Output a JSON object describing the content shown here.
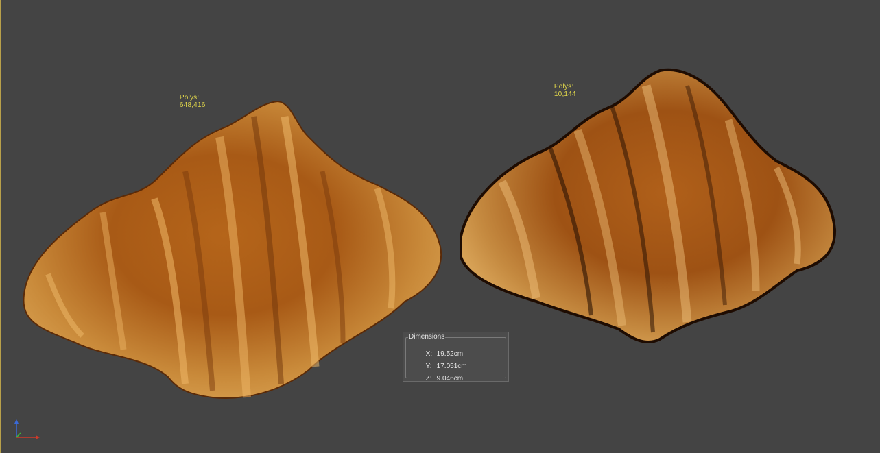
{
  "viewport": {
    "left_model": {
      "polys_label": "Polys:",
      "polys_value": "648,416"
    },
    "right_model": {
      "polys_label": "Polys:",
      "polys_value": "10,144"
    }
  },
  "dimensions": {
    "title": "Dimensions",
    "x_label": "X:",
    "x_value": "19.52cm",
    "y_label": "Y:",
    "y_value": "17.051cm",
    "z_label": "Z:",
    "z_value": "9.046cm"
  },
  "colors": {
    "background": "#444444",
    "stats_text": "#e2d84a",
    "gizmo_x": "#d03a2a",
    "gizmo_y": "#3fb83a",
    "gizmo_z": "#3a6ad8"
  },
  "icons": [
    "axis-gizmo-icon"
  ]
}
